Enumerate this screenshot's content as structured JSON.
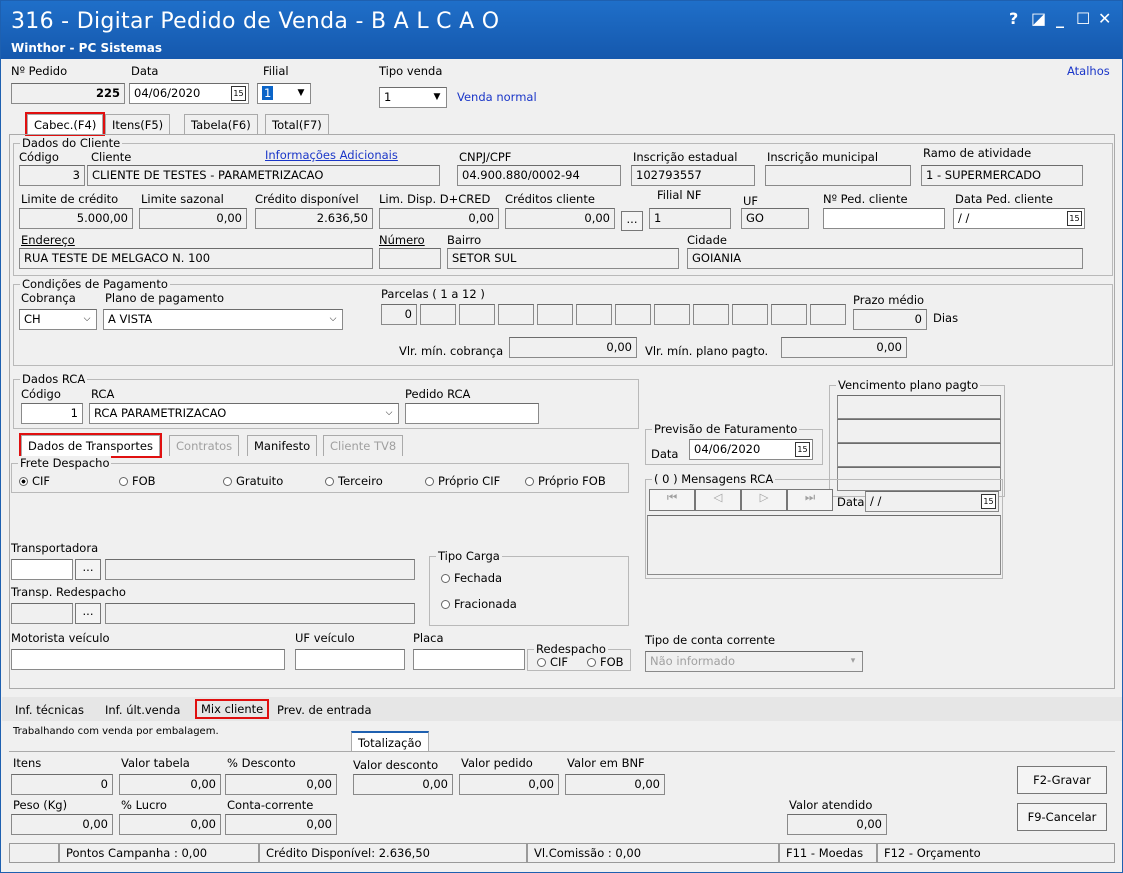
{
  "window": {
    "title": "316 - Digitar Pedido de Venda - B A L C A O",
    "subtitle": "Winthor - PC Sistemas",
    "controls": {
      "help": "?",
      "restore": "◪",
      "minimize": "_",
      "maximize": "☐",
      "close": "✕"
    }
  },
  "header": {
    "pedido_label": "Nº Pedido",
    "pedido_value": "225",
    "data_label": "Data",
    "data_value": "04/06/2020",
    "filial_label": "Filial",
    "filial_value": "1",
    "tipo_venda_label": "Tipo venda",
    "tipo_venda_value": "1",
    "tipo_venda_desc": "Venda normal",
    "atalhos": "Atalhos"
  },
  "tabs": [
    "Cabec.(F4)",
    "Itens(F5)",
    "Tabela(F6)",
    "Total(F7)"
  ],
  "cliente": {
    "group": "Dados do Cliente",
    "codigo_label": "Código",
    "codigo": "3",
    "cliente_label": "Cliente",
    "cliente": "CLIENTE DE TESTES - PARAMETRIZACAO",
    "info_link": "Informações Adicionais",
    "cnpj_label": "CNPJ/CPF",
    "cnpj": "04.900.880/0002-94",
    "ie_label": "Inscrição estadual",
    "ie": "102793557",
    "im_label": "Inscrição municipal",
    "im": "",
    "ramo_label": "Ramo de atividade",
    "ramo": "1 - SUPERMERCADO",
    "lim_credito_label": "Limite de crédito",
    "lim_credito": "5.000,00",
    "lim_sazonal_label": "Limite sazonal",
    "lim_sazonal": "0,00",
    "credito_disp_label": "Crédito disponível",
    "credito_disp": "2.636,50",
    "lim_disp_label": "Lim. Disp. D+CRED",
    "lim_disp": "0,00",
    "creditos_cliente_label": "Créditos cliente",
    "creditos_cliente": "0,00",
    "filial_nf_label": "Filial NF",
    "filial_nf": "1",
    "uf_label": "UF",
    "uf": "GO",
    "ped_cliente_label": "Nº Ped. cliente",
    "data_ped_label": "Data Ped. cliente",
    "data_ped": "/ /",
    "endereco_label": "Endereço",
    "endereco": "RUA TESTE DE MELGACO N. 100",
    "numero_label": "Número",
    "bairro_label": "Bairro",
    "bairro": "SETOR SUL",
    "cidade_label": "Cidade",
    "cidade": "GOIANIA",
    "ellipsis": "..."
  },
  "pagamento": {
    "group": "Condições de Pagamento",
    "cobranca_label": "Cobrança",
    "cobranca": "CH",
    "plano_label": "Plano de pagamento",
    "plano": "A VISTA",
    "parcelas_label": "Parcelas ( 1 a 12 )",
    "parcela1": "0",
    "prazo_label": "Prazo médio",
    "prazo": "0",
    "dias": "Dias",
    "vlr_min_cob_label": "Vlr. mín. cobrança",
    "vlr_min_cob": "0,00",
    "vlr_min_plano_label": "Vlr. mín. plano pagto.",
    "vlr_min_plano": "0,00"
  },
  "rca": {
    "group": "Dados RCA",
    "codigo_label": "Código",
    "codigo": "1",
    "rca_label": "RCA",
    "rca": "RCA PARAMETRIZACAO",
    "pedido_label": "Pedido RCA"
  },
  "vencimento": {
    "group": "Vencimento plano pagto"
  },
  "previsao": {
    "group": "Previsão de Faturamento",
    "data_label": "Data",
    "data": "04/06/2020"
  },
  "mensagens": {
    "group": "( 0 ) Mensagens RCA",
    "data_label": "Data",
    "data": "/ /"
  },
  "subtabs": [
    "Dados de Transportes",
    "Contratos",
    "Manifesto",
    "Cliente TV8"
  ],
  "frete": {
    "group": "Frete Despacho",
    "options": [
      "CIF",
      "FOB",
      "Gratuito",
      "Terceiro",
      "Próprio CIF",
      "Próprio FOB"
    ]
  },
  "transporte": {
    "transportadora_label": "Transportadora",
    "redespacho_label": "Transp. Redespacho",
    "tipo_carga_group": "Tipo Carga",
    "fechada": "Fechada",
    "fracionada": "Fracionada",
    "motorista_label": "Motorista veículo",
    "uf_veiculo_label": "UF veículo",
    "placa_label": "Placa",
    "redespacho_group": "Redespacho",
    "cif": "CIF",
    "fob": "FOB",
    "tipo_conta_label": "Tipo de conta corrente",
    "tipo_conta": "Não informado"
  },
  "bottom_tabs": [
    "Inf. técnicas",
    "Inf. últ.venda",
    "Mix cliente",
    "Prev. de entrada"
  ],
  "embalagem_note": "Trabalhando com venda por embalagem.",
  "totalizacao": {
    "tab": "Totalização",
    "itens_label": "Itens",
    "itens": "0",
    "valor_tabela_label": "Valor tabela",
    "valor_tabela": "0,00",
    "desconto_label": "% Desconto",
    "desconto": "0,00",
    "valor_desconto_label": "Valor desconto",
    "valor_desconto": "0,00",
    "valor_pedido_label": "Valor pedido",
    "valor_pedido": "0,00",
    "valor_bnf_label": "Valor em BNF",
    "valor_bnf": "0,00",
    "peso_label": "Peso (Kg)",
    "peso": "0,00",
    "lucro_label": "% Lucro",
    "lucro": "0,00",
    "conta_corrente_label": "Conta-corrente",
    "conta_corrente": "0,00",
    "valor_atendido_label": "Valor atendido",
    "valor_atendido": "0,00"
  },
  "buttons": {
    "gravar": "F2-Gravar",
    "cancelar": "F9-Cancelar"
  },
  "status": {
    "pontos": "Pontos Campanha : 0,00",
    "credito": "Crédito Disponível: 2.636,50",
    "comissao": "Vl.Comissão : 0,00",
    "moedas": "F11 - Moedas",
    "orcamento": "F12 - Orçamento"
  }
}
